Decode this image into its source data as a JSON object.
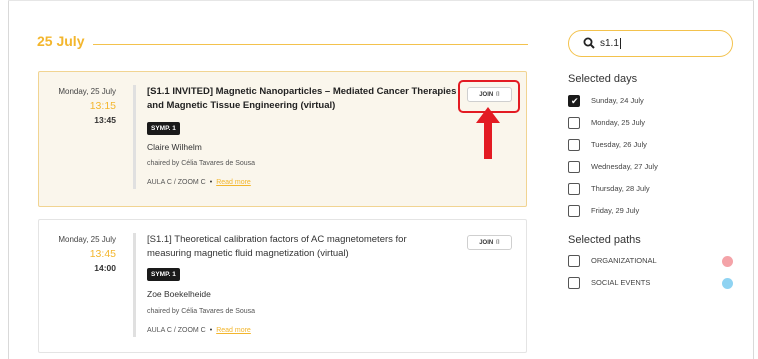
{
  "program": {
    "date_heading": "25 July"
  },
  "sessions": [
    {
      "day": "Monday, 25 July",
      "start": "13:15",
      "end": "13:45",
      "title_line1": "[S1.1 INVITED] Magnetic Nanoparticles – Mediated Cancer Therapies",
      "title_line2": "and Magnetic Tissue Engineering (virtual)",
      "badge": "SYMP. 1",
      "speaker": "Claire Wilhelm",
      "chair": "chaired by Célia Tavares de Sousa",
      "room": "AULA C / ZOOM C",
      "read_more": "Read more",
      "join_label": "JOIN",
      "join_icon": "camera-icon"
    },
    {
      "day": "Monday, 25 July",
      "start": "13:45",
      "end": "14:00",
      "title_line1": "[S1.1] Theoretical calibration factors of AC magnetometers for",
      "title_line2": "measuring magnetic fluid magnetization (virtual)",
      "badge": "SYMP. 1",
      "speaker": "Zoe Boekelheide",
      "chair": "chaired by Célia Tavares de Sousa",
      "room": "AULA C / ZOOM C",
      "read_more": "Read more",
      "join_label": "JOIN",
      "join_icon": "camera-icon"
    }
  ],
  "search": {
    "value": "s1.1",
    "icon": "search-icon"
  },
  "filters": {
    "days_heading": "Selected days",
    "days": [
      {
        "label": "Sunday, 24 July",
        "checked": true
      },
      {
        "label": "Monday, 25 July",
        "checked": false
      },
      {
        "label": "Tuesday, 26 July",
        "checked": false
      },
      {
        "label": "Wednesday, 27 July",
        "checked": false
      },
      {
        "label": "Thursday, 28 July",
        "checked": false
      },
      {
        "label": "Friday, 29 July",
        "checked": false
      }
    ],
    "paths_heading": "Selected paths",
    "paths": [
      {
        "label": "ORGANIZATIONAL",
        "checked": false,
        "color": "#f4a3a8"
      },
      {
        "label": "SOCIAL EVENTS",
        "checked": false,
        "color": "#8fd3f2"
      }
    ]
  },
  "annotation": {
    "color": "#e31b23"
  },
  "colors": {
    "accent": "#f3b62d",
    "active_card_bg": "#faf6ec",
    "badge_bg": "#1a1a1a"
  }
}
